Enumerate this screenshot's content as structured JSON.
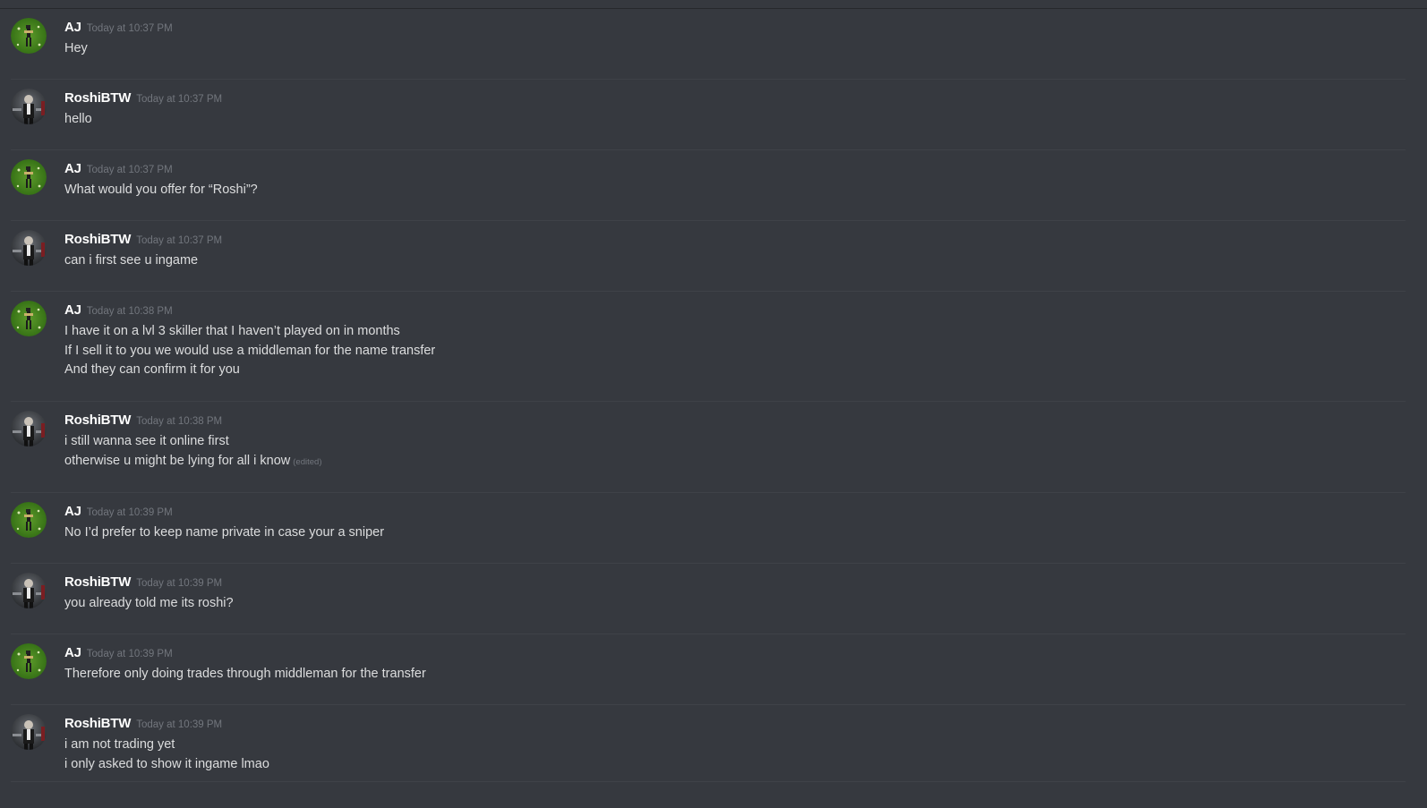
{
  "messages": [
    {
      "author": "AJ",
      "timestamp": "Today at 10:37 PM",
      "avatar": "aj",
      "lines": [
        "Hey"
      ]
    },
    {
      "author": "RoshiBTW",
      "timestamp": "Today at 10:37 PM",
      "avatar": "roshi",
      "lines": [
        "hello"
      ]
    },
    {
      "author": "AJ",
      "timestamp": "Today at 10:37 PM",
      "avatar": "aj",
      "lines": [
        "What would you offer for “Roshi”?"
      ]
    },
    {
      "author": "RoshiBTW",
      "timestamp": "Today at 10:37 PM",
      "avatar": "roshi",
      "lines": [
        "can i first see u ingame"
      ]
    },
    {
      "author": "AJ",
      "timestamp": "Today at 10:38 PM",
      "avatar": "aj",
      "lines": [
        "I have it on a lvl 3 skiller that I haven’t played on in months",
        "If I sell it to you we would use a middleman for the name transfer",
        "And they can confirm it for you"
      ]
    },
    {
      "author": "RoshiBTW",
      "timestamp": "Today at 10:38 PM",
      "avatar": "roshi",
      "lines": [
        "i still wanna see it online first",
        "otherwise u might be lying for all i know"
      ],
      "edited": "(edited)"
    },
    {
      "author": "AJ",
      "timestamp": "Today at 10:39 PM",
      "avatar": "aj",
      "lines": [
        "No I’d prefer to keep name private in case your a sniper"
      ]
    },
    {
      "author": "RoshiBTW",
      "timestamp": "Today at 10:39 PM",
      "avatar": "roshi",
      "lines": [
        "you already told me its roshi?"
      ]
    },
    {
      "author": "AJ",
      "timestamp": "Today at 10:39 PM",
      "avatar": "aj",
      "lines": [
        "Therefore only doing trades through middleman for the transfer"
      ]
    },
    {
      "author": "RoshiBTW",
      "timestamp": "Today at 10:39 PM",
      "avatar": "roshi",
      "lines": [
        "i am not trading yet",
        "i only asked to show it ingame lmao"
      ]
    }
  ],
  "colors": {
    "background": "#36393f",
    "username": "#ffffff",
    "timestamp": "#72767d",
    "text": "#dcddde",
    "divider": "#3f4248"
  }
}
